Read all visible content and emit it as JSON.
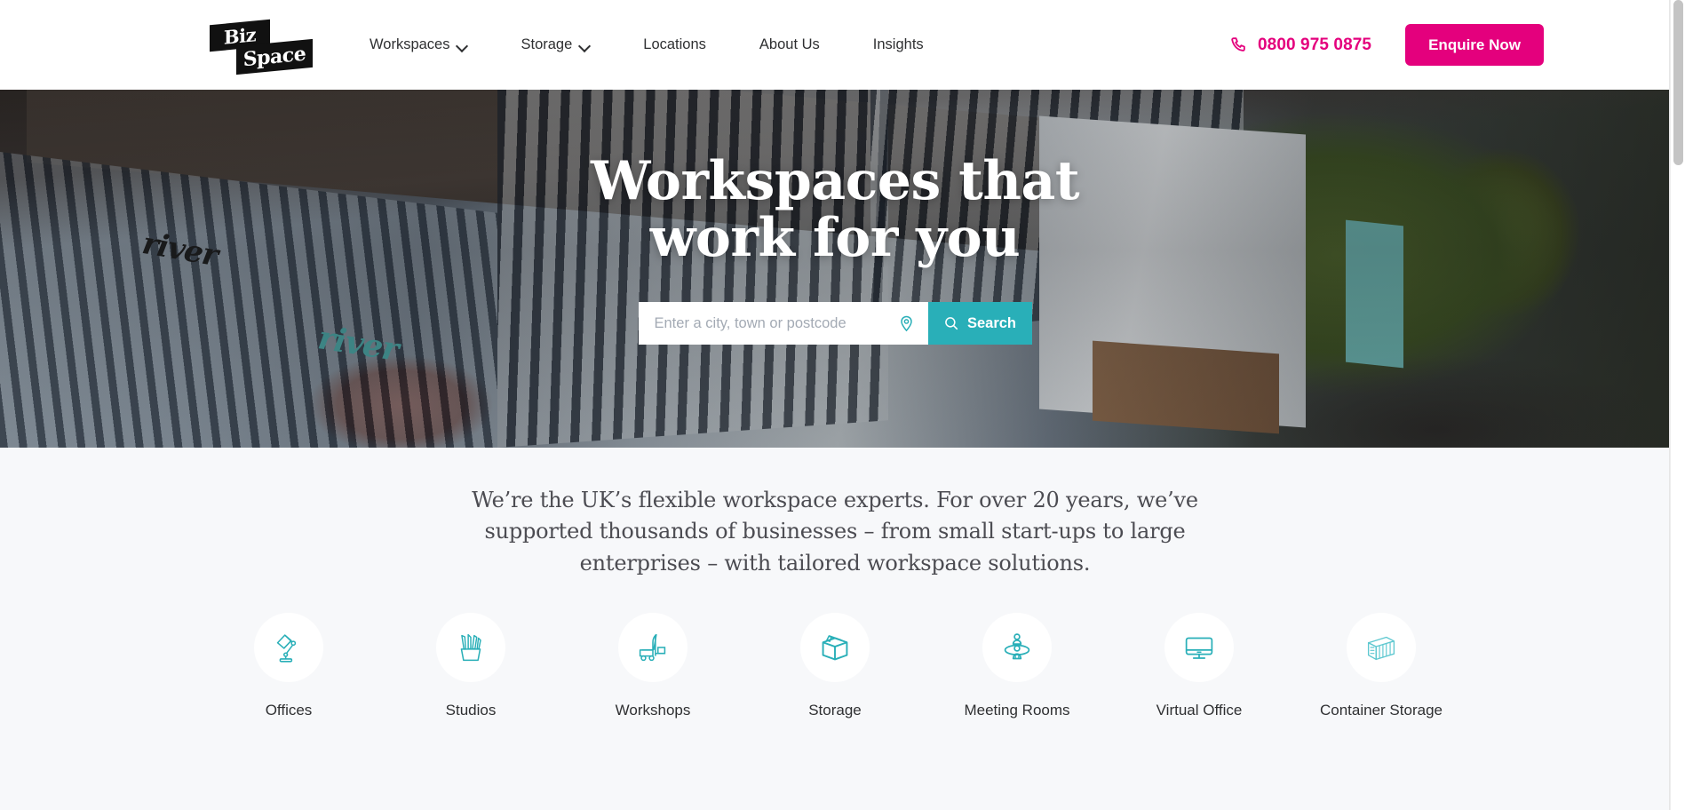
{
  "site": {
    "brand_primary": "#E4007D",
    "brand_teal": "#29AFB8",
    "page_background": "#F7F8FA"
  },
  "header": {
    "logo": {
      "line1": "Biz",
      "line2": "Space",
      "icon": "bizspace-logo"
    },
    "nav": [
      {
        "label": "Workspaces",
        "has_dropdown": true
      },
      {
        "label": "Storage",
        "has_dropdown": true
      },
      {
        "label": "Locations",
        "has_dropdown": false
      },
      {
        "label": "About Us",
        "has_dropdown": false
      },
      {
        "label": "Insights",
        "has_dropdown": false
      }
    ],
    "phone": {
      "number": "0800 975 0875",
      "icon": "phone-icon",
      "color": "#E4007D"
    },
    "cta": {
      "label": "Enquire Now",
      "color": "#E4007D"
    }
  },
  "hero": {
    "title": "Workspaces that work for you",
    "title_line1": "Workspaces that",
    "title_line2": "work for you",
    "building_signage": "river",
    "search": {
      "placeholder": "Enter a city, town or postcode",
      "value": "",
      "location_icon": "map-pin-icon",
      "button_label": "Search",
      "button_icon": "search-icon",
      "button_color": "#29AFB8"
    }
  },
  "intro": {
    "text": "We’re the UK’s flexible workspace experts. For over 20 years, we’ve supported thousands of businesses – from small start-ups to large enterprises – with tailored workspace solutions."
  },
  "categories": [
    {
      "label": "Offices",
      "icon": "desk-lamp-icon"
    },
    {
      "label": "Studios",
      "icon": "pencil-cup-icon"
    },
    {
      "label": "Workshops",
      "icon": "forklift-icon"
    },
    {
      "label": "Storage",
      "icon": "box-icon"
    },
    {
      "label": "Meeting Rooms",
      "icon": "meeting-table-icon"
    },
    {
      "label": "Virtual Office",
      "icon": "monitor-icon"
    },
    {
      "label": "Container Storage",
      "icon": "shipping-container-icon"
    }
  ]
}
